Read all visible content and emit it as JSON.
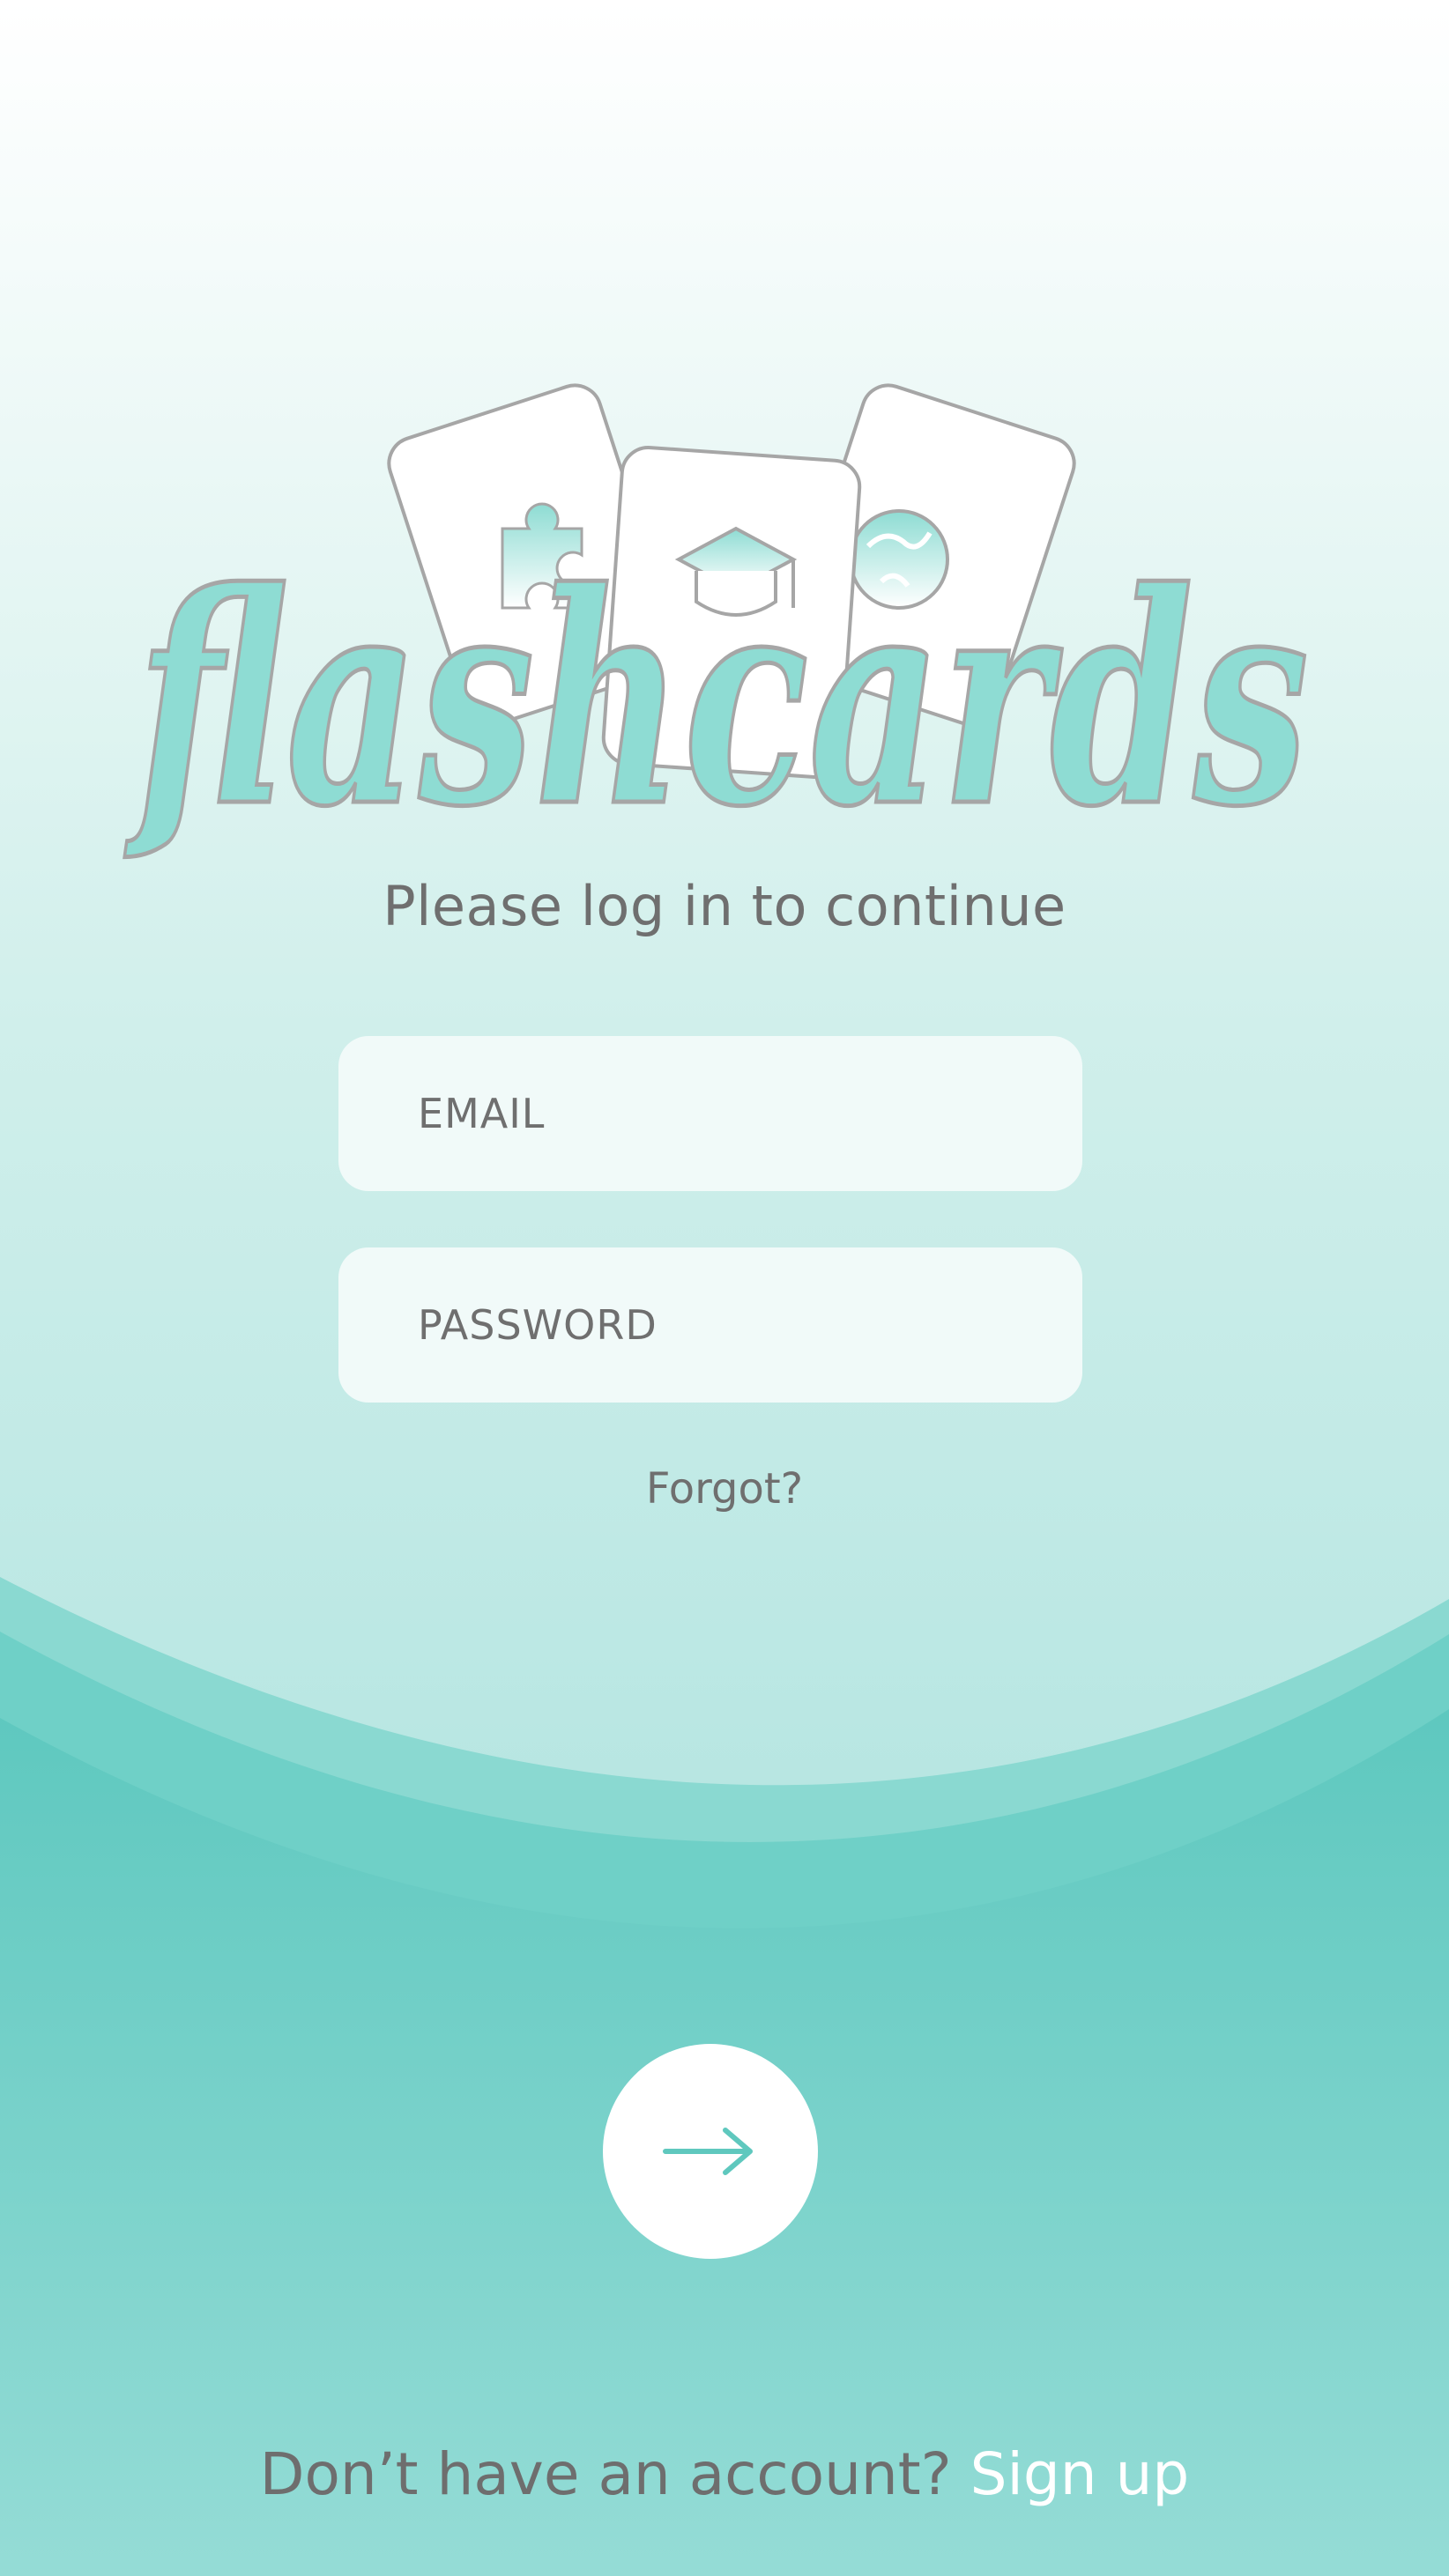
{
  "logo": {
    "wordmark": "flashcards",
    "cards": [
      "puzzle-icon",
      "graduation-cap-icon",
      "globe-icon"
    ]
  },
  "subtitle": "Please log in to continue",
  "form": {
    "email_placeholder": "EMAIL",
    "password_placeholder": "PASSWORD",
    "forgot_label": "Forgot?"
  },
  "submit": {
    "icon": "arrow-right-icon"
  },
  "footer": {
    "prompt": "Don’t have an account?",
    "signup_label": "Sign up"
  },
  "colors": {
    "accent": "#5fc8be",
    "logo_fill": "#8edcd3",
    "logo_outline": "#a6a6a6",
    "text": "#6f6f6f",
    "field_bg": "#f1faf9"
  }
}
